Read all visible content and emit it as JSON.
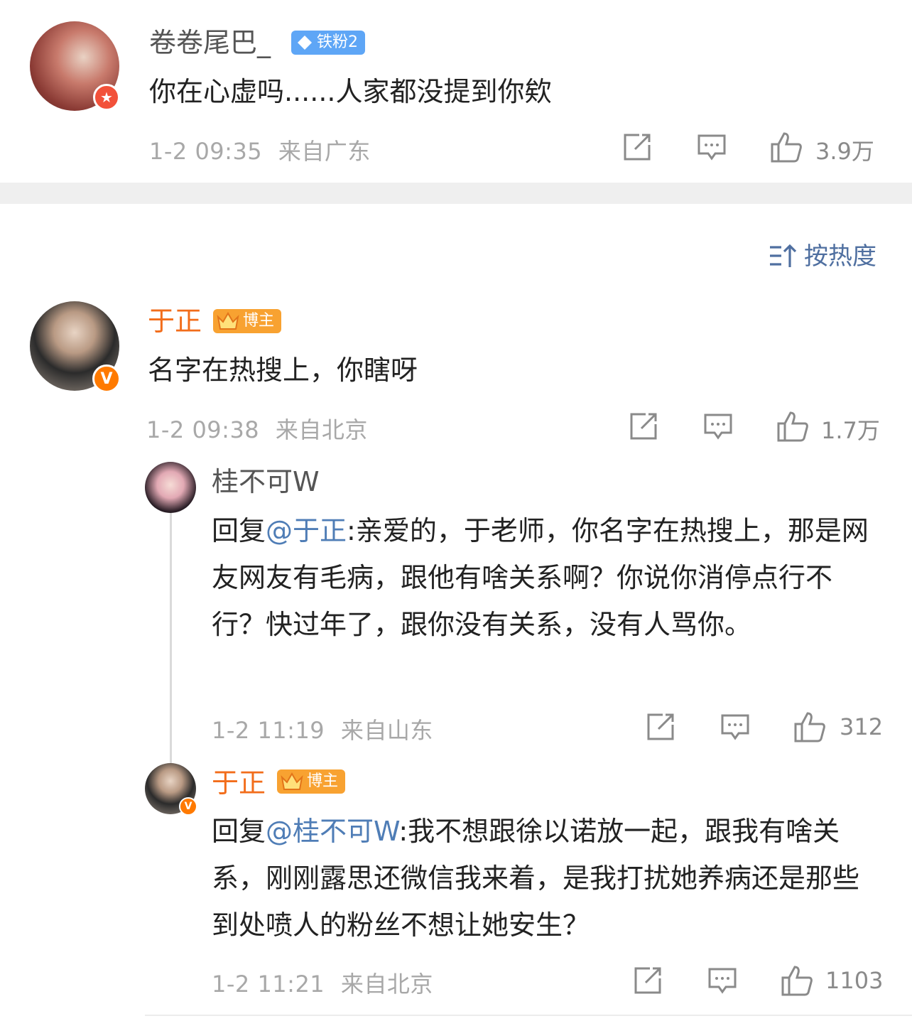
{
  "comments": [
    {
      "username": "卷卷尾巴_",
      "badge": "铁粉2",
      "text": "你在心虚吗......人家都没提到你欸",
      "date": "1-2 09:35",
      "location": "来自广东",
      "likes": "3.9万"
    },
    {
      "username": "于正",
      "badge": "博主",
      "text": "名字在热搜上，你瞎呀",
      "date": "1-2 09:38",
      "location": "来自北京",
      "likes": "1.7万"
    }
  ],
  "sort_label": "按热度",
  "replies": [
    {
      "username": "桂不可W",
      "reply_prefix": "回复",
      "mention": "@于正",
      "text": ":亲爱的，于老师，你名字在热搜上，那是网友网友有毛病，跟他有啥关系啊？你说你消停点行不行？快过年了，跟你没有关系，没有人骂你。",
      "date": "1-2 11:19",
      "location": "来自山东",
      "likes": "312"
    },
    {
      "username": "于正",
      "badge": "博主",
      "reply_prefix": "回复",
      "mention": "@桂不可W",
      "text": ":我不想跟徐以诺放一起，跟我有啥关系，刚刚露思还微信我来着，是我打扰她养病还是那些到处喷人的粉丝不想让她安生？",
      "date": "1-2 11:21",
      "location": "来自北京",
      "likes": "1103"
    }
  ],
  "colors": {
    "orange": "#f26d1b",
    "link": "#4f7db6",
    "meta": "#a8a8a8"
  },
  "icons": [
    "share-icon",
    "comment-icon",
    "like-icon",
    "sort-icon"
  ]
}
